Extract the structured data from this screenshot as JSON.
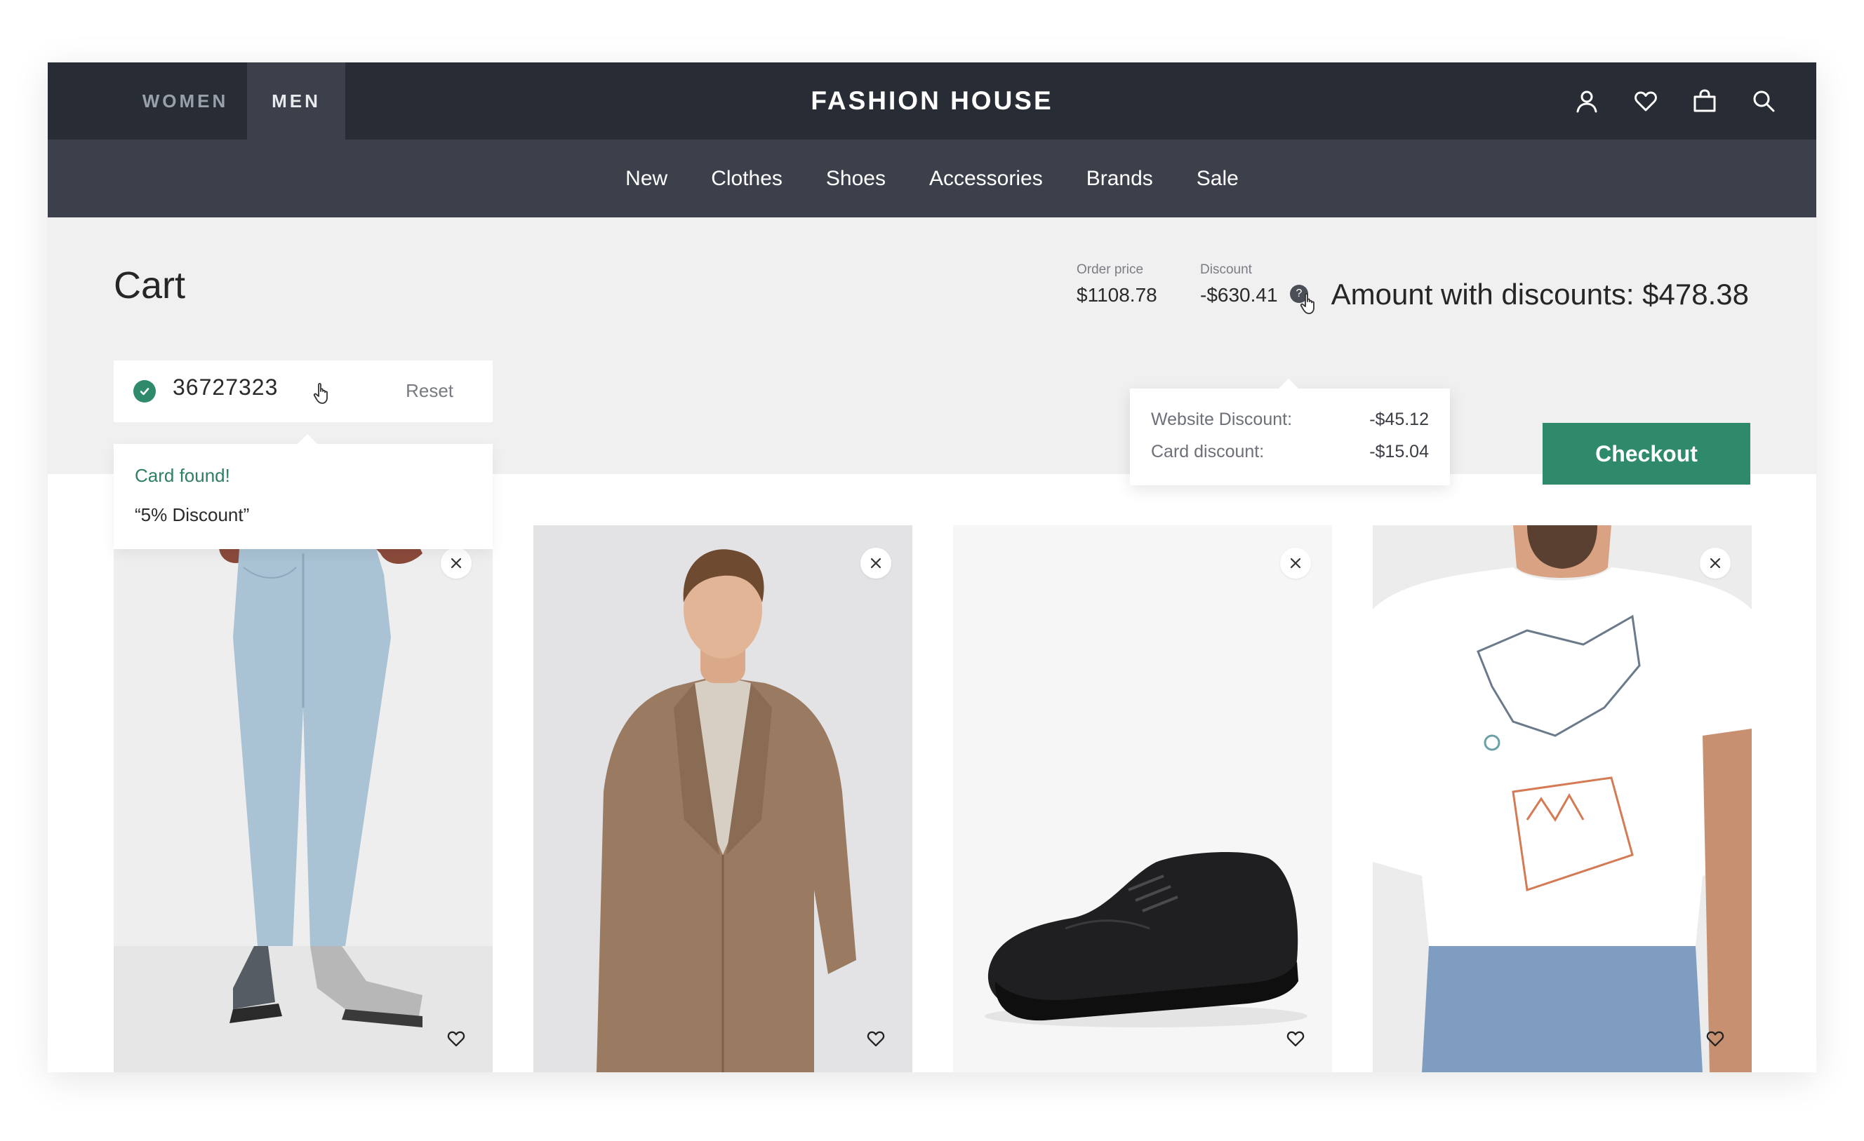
{
  "header": {
    "tabs": [
      {
        "label": "WOMEN",
        "active": false
      },
      {
        "label": "MEN",
        "active": true
      }
    ],
    "brand": "FASHION HOUSE",
    "icons": [
      "user-icon",
      "heart-icon",
      "bag-icon",
      "search-icon"
    ]
  },
  "nav": {
    "items": [
      "New",
      "Clothes",
      "Shoes",
      "Accessories",
      "Brands",
      "Sale"
    ]
  },
  "cart": {
    "title": "Cart",
    "card_number": "36727323",
    "reset_label": "Reset",
    "card_popover": {
      "status": "Card found!",
      "discount_name": "“5% Discount”"
    },
    "order_price_label": "Order price",
    "order_price": "$1108.78",
    "discount_label": "Discount",
    "discount_value": "-$630.41",
    "help_label": "?",
    "amount_text": "Amount with discounts: $478.38",
    "discount_breakdown": [
      {
        "label": "Website Discount:",
        "value": "-$45.12"
      },
      {
        "label": "Card discount:",
        "value": "-$15.04"
      }
    ],
    "checkout_label": "Checkout"
  },
  "products": [
    {
      "item": "light-blue jeans",
      "image_icon": "jeans-image"
    },
    {
      "item": "brown suit",
      "image_icon": "suit-image"
    },
    {
      "item": "black shoe",
      "image_icon": "shoe-image"
    },
    {
      "item": "white graphic t-shirt",
      "image_icon": "tshirt-image"
    }
  ],
  "colors": {
    "topbar": "#282c35",
    "navbar": "#3b404b",
    "accent": "#2f8a6c",
    "cart_background": "#f0f0f0"
  }
}
